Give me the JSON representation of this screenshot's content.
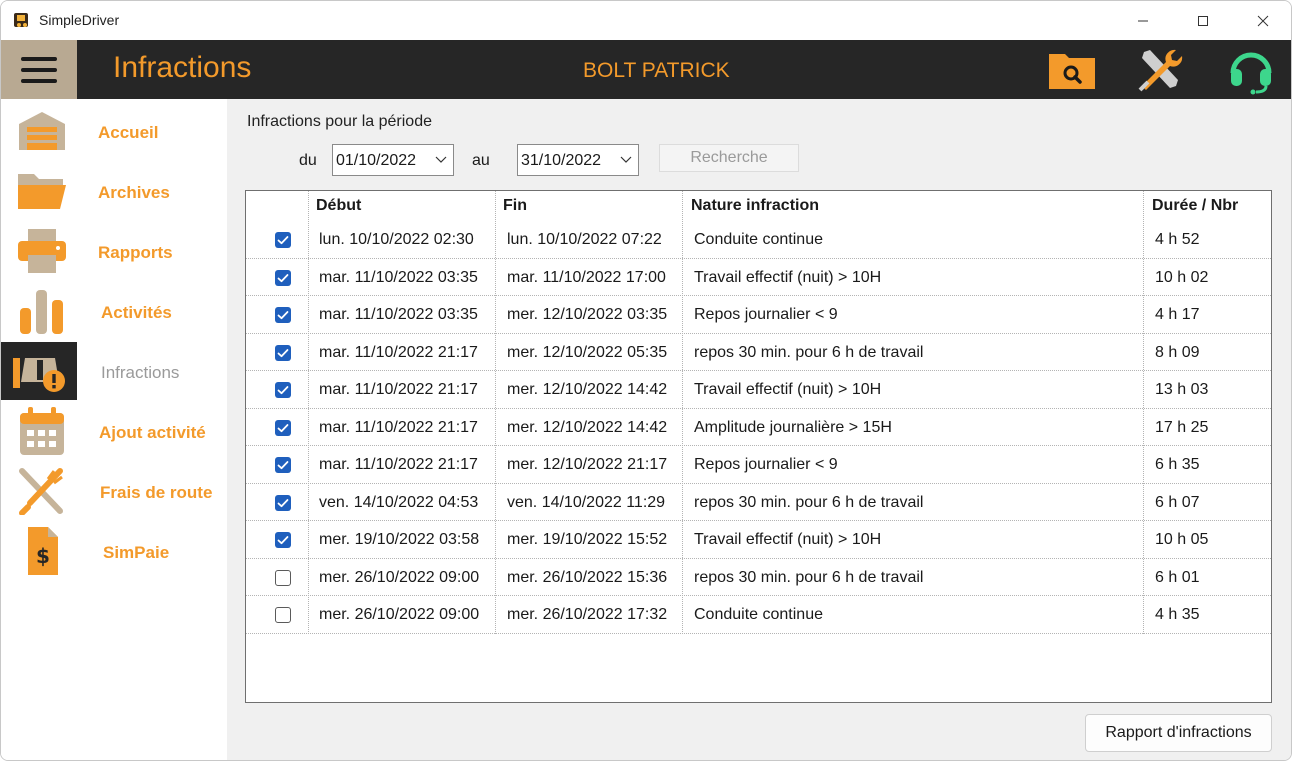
{
  "window": {
    "title": "SimpleDriver"
  },
  "header": {
    "title": "Infractions",
    "driver": "BOLT PATRICK"
  },
  "colors": {
    "accent": "#f39a2b",
    "header_bg": "#262626",
    "menu_btn_bg": "#b8a992",
    "checkbox_blue": "#1f5fbd",
    "support_green": "#3dd68c"
  },
  "sidebar": {
    "items": [
      {
        "label": "Accueil",
        "icon": "garage-icon",
        "active": false
      },
      {
        "label": "Archives",
        "icon": "folder-icon",
        "active": false
      },
      {
        "label": "Rapports",
        "icon": "printer-icon",
        "active": false
      },
      {
        "label": "Activités",
        "icon": "bar-chart-icon",
        "active": false
      },
      {
        "label": "Infractions",
        "icon": "infraction-warning-icon",
        "active": true
      },
      {
        "label": "Ajout activité",
        "icon": "calendar-icon",
        "active": false
      },
      {
        "label": "Frais de route",
        "icon": "fork-knife-icon",
        "active": false
      },
      {
        "label": "SimPaie",
        "icon": "payslip-icon",
        "active": false
      }
    ]
  },
  "filter": {
    "period_label": "Infractions pour la période",
    "from_label": "du",
    "from_value": "01/10/2022",
    "to_label": "au",
    "to_value": "31/10/2022",
    "search_label": "Recherche"
  },
  "table": {
    "columns": [
      "Début",
      "Fin",
      "Nature infraction",
      "Durée / Nbr"
    ],
    "rows": [
      {
        "checked": true,
        "debut": "lun. 10/10/2022 02:30",
        "fin": "lun. 10/10/2022 07:22",
        "nature": "Conduite continue",
        "duree": "4 h 52"
      },
      {
        "checked": true,
        "debut": "mar. 11/10/2022 03:35",
        "fin": "mar. 11/10/2022 17:00",
        "nature": "Travail effectif (nuit) > 10H",
        "duree": "10 h 02"
      },
      {
        "checked": true,
        "debut": "mar. 11/10/2022 03:35",
        "fin": "mer. 12/10/2022 03:35",
        "nature": "Repos journalier < 9",
        "duree": "4 h 17"
      },
      {
        "checked": true,
        "debut": "mar. 11/10/2022 21:17",
        "fin": "mer. 12/10/2022 05:35",
        "nature": "repos 30 min. pour 6 h de travail",
        "duree": "8 h 09"
      },
      {
        "checked": true,
        "debut": "mar. 11/10/2022 21:17",
        "fin": "mer. 12/10/2022 14:42",
        "nature": "Travail effectif (nuit) > 10H",
        "duree": "13 h 03"
      },
      {
        "checked": true,
        "debut": "mar. 11/10/2022 21:17",
        "fin": "mer. 12/10/2022 14:42",
        "nature": "Amplitude journalière > 15H",
        "duree": "17 h 25"
      },
      {
        "checked": true,
        "debut": "mar. 11/10/2022 21:17",
        "fin": "mer. 12/10/2022 21:17",
        "nature": "Repos journalier < 9",
        "duree": "6 h 35"
      },
      {
        "checked": true,
        "debut": "ven. 14/10/2022 04:53",
        "fin": "ven. 14/10/2022 11:29",
        "nature": "repos 30 min. pour 6 h de travail",
        "duree": "6 h 07"
      },
      {
        "checked": true,
        "debut": "mer. 19/10/2022 03:58",
        "fin": "mer. 19/10/2022 15:52",
        "nature": "Travail effectif (nuit) > 10H",
        "duree": "10 h 05"
      },
      {
        "checked": false,
        "debut": "mer. 26/10/2022 09:00",
        "fin": "mer. 26/10/2022 15:36",
        "nature": "repos 30 min. pour 6 h de travail",
        "duree": "6 h 01"
      },
      {
        "checked": false,
        "debut": "mer. 26/10/2022 09:00",
        "fin": "mer. 26/10/2022 17:32",
        "nature": "Conduite continue",
        "duree": "4 h 35"
      }
    ]
  },
  "footer": {
    "report_button": "Rapport d'infractions"
  }
}
